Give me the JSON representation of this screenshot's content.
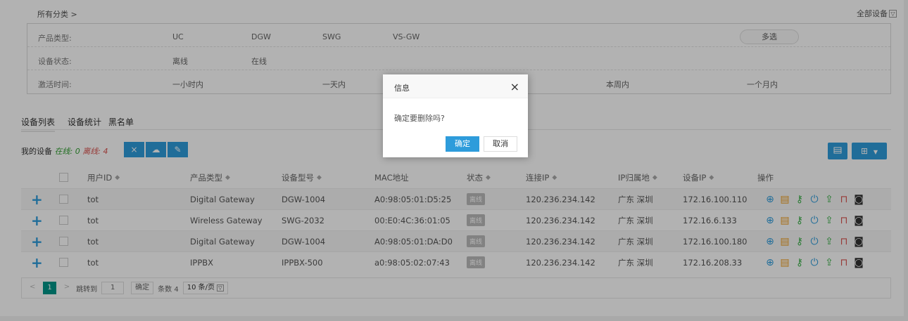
{
  "breadcrumb": "所有分类 >",
  "all_devices": "全部设备",
  "filters": {
    "product_type": {
      "label": "产品类型:",
      "options": [
        "UC",
        "DGW",
        "SWG",
        "VS-GW"
      ],
      "multi_select": "多选"
    },
    "device_status": {
      "label": "设备状态:",
      "options": [
        "离线",
        "在线"
      ]
    },
    "activation_time": {
      "label": "激活时间:",
      "options": [
        "一小时内",
        "一天内",
        "本周内",
        "一个月内"
      ]
    }
  },
  "tabs": [
    "设备列表",
    "设备统计",
    "黑名单"
  ],
  "summary": {
    "prefix": "我的设备",
    "online_label": "在线:",
    "online_count": "0",
    "offline_label": "离线:",
    "offline_count": "4"
  },
  "toolbar": {
    "delete": "×",
    "upload": "☁",
    "edit": "✎"
  },
  "columns": [
    "用户ID",
    "产品类型",
    "设备型号",
    "MAC地址",
    "状态",
    "连接IP",
    "IP归属地",
    "设备IP",
    "操作"
  ],
  "rows": [
    {
      "user": "tot",
      "product": "Digital Gateway",
      "model": "DGW-1004",
      "mac": "A0:98:05:01:D5:25",
      "status": "离线",
      "conn_ip": "120.236.234.142",
      "location": "广东 深圳",
      "device_ip": "172.16.100.110"
    },
    {
      "user": "tot",
      "product": "Wireless Gateway",
      "model": "SWG-2032",
      "mac": "00:E0:4C:36:01:05",
      "status": "离线",
      "conn_ip": "120.236.234.142",
      "location": "广东 深圳",
      "device_ip": "172.16.6.133"
    },
    {
      "user": "tot",
      "product": "Digital Gateway",
      "model": "DGW-1004",
      "mac": "A0:98:05:01:DA:D0",
      "status": "离线",
      "conn_ip": "120.236.234.142",
      "location": "广东 深圳",
      "device_ip": "172.16.100.180"
    },
    {
      "user": "tot",
      "product": "IPPBX",
      "model": "IPPBX-500",
      "mac": "a0:98:05:02:07:43",
      "status": "离线",
      "conn_ip": "120.236.234.142",
      "location": "广东 深圳",
      "device_ip": "172.16.208.33"
    }
  ],
  "op_icons": [
    "globe-icon",
    "config-icon",
    "key-icon",
    "power-icon",
    "upgrade-icon",
    "delete-icon",
    "remote-icon"
  ],
  "pager": {
    "prev": "<",
    "page": "1",
    "next": ">",
    "goto_label": "跳转到",
    "goto_value": "1",
    "confirm": "确定",
    "total": "条数 4",
    "per_page": "10 条/页"
  },
  "dialog": {
    "title": "信息",
    "close": "×",
    "message": "确定要删除吗?",
    "ok": "确定",
    "cancel": "取消"
  },
  "colors": {
    "primary": "#2e9cdb",
    "online": "#2e9e2e",
    "offline": "#d9534f",
    "page_green": "#009688"
  }
}
